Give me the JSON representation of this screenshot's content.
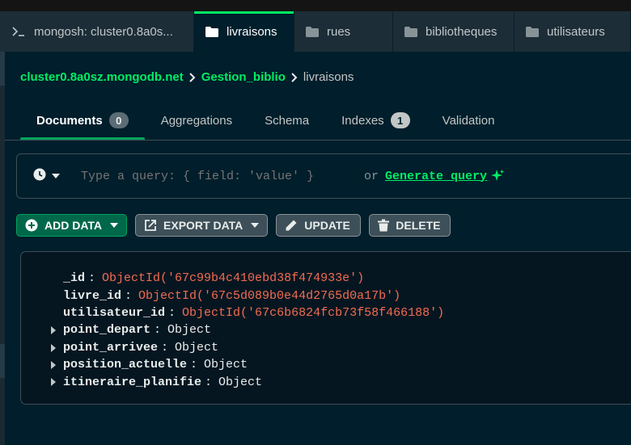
{
  "colors": {
    "accent": "#00ed64",
    "button_primary": "#00684a",
    "objectid": "#f26c4f",
    "background": "#001e2b"
  },
  "tabs": [
    {
      "label": "mongosh: cluster0.8a0s...",
      "icon": "terminal-icon"
    },
    {
      "label": "livraisons",
      "icon": "folder-icon"
    },
    {
      "label": "rues",
      "icon": "folder-icon"
    },
    {
      "label": "bibliotheques",
      "icon": "folder-icon"
    },
    {
      "label": "utilisateurs",
      "icon": "folder-icon"
    }
  ],
  "breadcrumb": {
    "cluster": "cluster0.8a0sz.mongodb.net",
    "database": "Gestion_biblio",
    "collection": "livraisons"
  },
  "subtabs": [
    {
      "label": "Documents",
      "count": "0"
    },
    {
      "label": "Aggregations"
    },
    {
      "label": "Schema"
    },
    {
      "label": "Indexes",
      "count": "1"
    },
    {
      "label": "Validation"
    }
  ],
  "query": {
    "placeholder": "Type a query: { field: 'value' }",
    "or_text": "or",
    "generate_label": "Generate query"
  },
  "toolbar": {
    "add_data": "ADD DATA",
    "export_data": "EXPORT DATA",
    "update": "UPDATE",
    "delete": "DELETE"
  },
  "document": {
    "fields": [
      {
        "key": "_id",
        "value": "ObjectId('67c99b4c410ebd38f474933e')",
        "kind": "oid"
      },
      {
        "key": "livre_id",
        "value": "ObjectId('67c5d089b0e44d2765d0a17b')",
        "kind": "oid"
      },
      {
        "key": "utilisateur_id",
        "value": "ObjectId('67c6b6824fcb73f58f466188')",
        "kind": "oid"
      },
      {
        "key": "point_depart",
        "value": "Object",
        "kind": "object"
      },
      {
        "key": "point_arrivee",
        "value": "Object",
        "kind": "object"
      },
      {
        "key": "position_actuelle",
        "value": "Object",
        "kind": "object"
      },
      {
        "key": "itineraire_planifie",
        "value": "Object",
        "kind": "object"
      }
    ]
  }
}
